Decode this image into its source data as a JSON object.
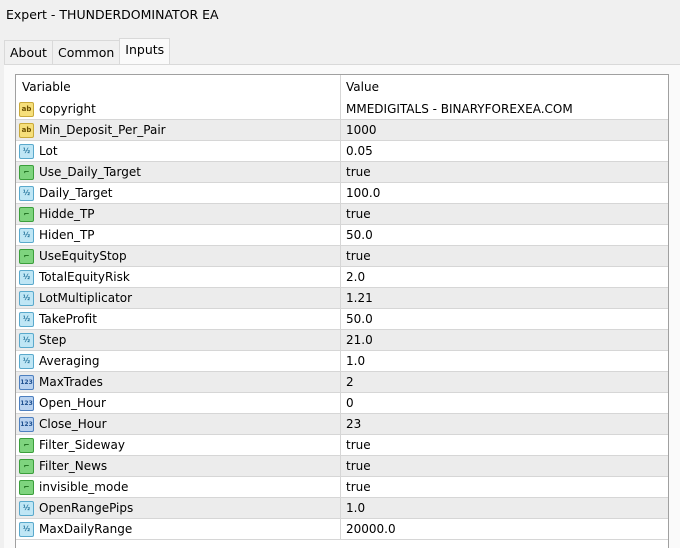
{
  "window": {
    "title": "Expert - THUNDERDOMINATOR EA"
  },
  "tabs": [
    {
      "label": "About"
    },
    {
      "label": "Common"
    },
    {
      "label": "Inputs",
      "active": true
    }
  ],
  "table": {
    "headers": {
      "variable": "Variable",
      "value": "Value"
    },
    "rows": [
      {
        "type": "string",
        "icon_text": "ab",
        "name": "copyright",
        "value": "MMEDIGITALS - BINARYFOREXEA.COM"
      },
      {
        "type": "string",
        "icon_text": "ab",
        "name": "Min_Deposit_Per_Pair",
        "value": "1000"
      },
      {
        "type": "double",
        "icon_text": "½",
        "name": "Lot",
        "value": "0.05"
      },
      {
        "type": "bool",
        "icon_text": "⌐",
        "name": "Use_Daily_Target",
        "value": "true"
      },
      {
        "type": "double",
        "icon_text": "½",
        "name": "Daily_Target",
        "value": "100.0"
      },
      {
        "type": "bool",
        "icon_text": "⌐",
        "name": "Hidde_TP",
        "value": "true"
      },
      {
        "type": "double",
        "icon_text": "½",
        "name": "Hiden_TP",
        "value": "50.0"
      },
      {
        "type": "bool",
        "icon_text": "⌐",
        "name": "UseEquityStop",
        "value": "true"
      },
      {
        "type": "double",
        "icon_text": "½",
        "name": "TotalEquityRisk",
        "value": "2.0"
      },
      {
        "type": "double",
        "icon_text": "½",
        "name": "LotMultiplicator",
        "value": "1.21"
      },
      {
        "type": "double",
        "icon_text": "½",
        "name": "TakeProfit",
        "value": "50.0"
      },
      {
        "type": "double",
        "icon_text": "½",
        "name": "Step",
        "value": "21.0"
      },
      {
        "type": "double",
        "icon_text": "½",
        "name": "Averaging",
        "value": "1.0"
      },
      {
        "type": "int",
        "icon_text": "123",
        "name": "MaxTrades",
        "value": "2"
      },
      {
        "type": "int",
        "icon_text": "123",
        "name": "Open_Hour",
        "value": "0"
      },
      {
        "type": "int",
        "icon_text": "123",
        "name": "Close_Hour",
        "value": "23"
      },
      {
        "type": "bool",
        "icon_text": "⌐",
        "name": "Filter_Sideway",
        "value": "true"
      },
      {
        "type": "bool",
        "icon_text": "⌐",
        "name": "Filter_News",
        "value": "true"
      },
      {
        "type": "bool",
        "icon_text": "⌐",
        "name": "invisible_mode",
        "value": "true"
      },
      {
        "type": "double",
        "icon_text": "½",
        "name": "OpenRangePips",
        "value": "1.0"
      },
      {
        "type": "double",
        "icon_text": "½",
        "name": "MaxDailyRange",
        "value": "20000.0"
      }
    ]
  }
}
